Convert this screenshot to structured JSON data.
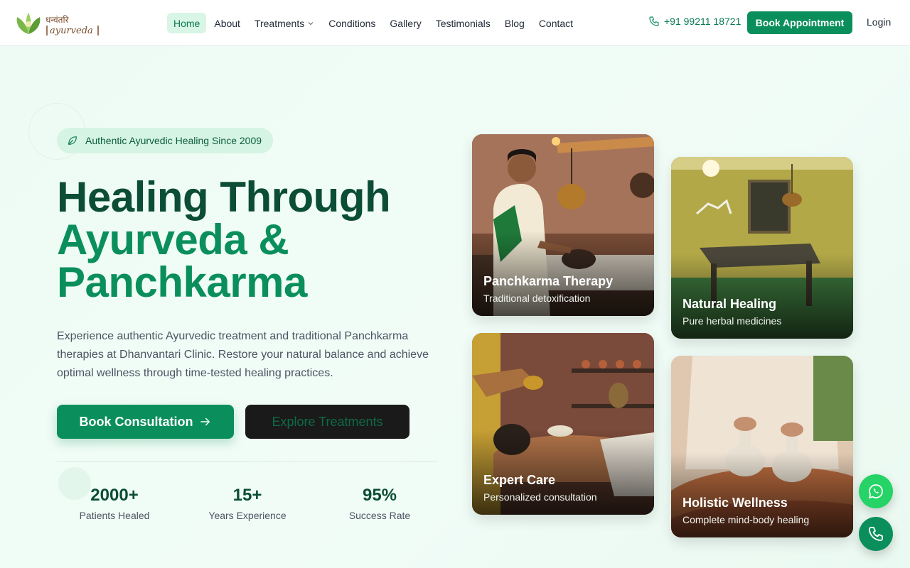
{
  "header": {
    "logo_text": "धन्वंतरि Ayurveda",
    "nav": [
      {
        "label": "Home"
      },
      {
        "label": "About"
      },
      {
        "label": "Treatments"
      },
      {
        "label": "Conditions"
      },
      {
        "label": "Gallery"
      },
      {
        "label": "Testimonials"
      },
      {
        "label": "Blog"
      },
      {
        "label": "Contact"
      }
    ],
    "phone": "+91 99211 18721",
    "book_label": "Book Appointment",
    "login_label": "Login"
  },
  "hero": {
    "badge": "Authentic Ayurvedic Healing Since 2009",
    "title_line1": "Healing Through",
    "title_line2": "Ayurveda &",
    "title_line3": "Panchkarma",
    "description": "Experience authentic Ayurvedic treatment and traditional Panchkarma therapies at Dhanvantari Clinic. Restore your natural balance and achieve optimal wellness through time-tested healing practices.",
    "primary_cta": "Book Consultation",
    "secondary_cta": "Explore Treatments",
    "stats": [
      {
        "value": "2000+",
        "label": "Patients Healed"
      },
      {
        "value": "15+",
        "label": "Years Experience"
      },
      {
        "value": "95%",
        "label": "Success Rate"
      }
    ]
  },
  "cards": [
    {
      "title": "Panchkarma Therapy",
      "subtitle": "Traditional detoxification"
    },
    {
      "title": "Natural Healing",
      "subtitle": "Pure herbal medicines"
    },
    {
      "title": "Expert Care",
      "subtitle": "Personalized consultation"
    },
    {
      "title": "Holistic Wellness",
      "subtitle": "Complete mind-body healing"
    }
  ],
  "colors": {
    "brand_green": "#0a8f5c",
    "dark_green": "#0b4d36",
    "whatsapp": "#25d366"
  },
  "icons": {
    "phone": "phone-icon",
    "leaf": "leaf-icon",
    "arrow": "arrow-right-icon",
    "whatsapp": "whatsapp-icon",
    "chevron": "chevron-down-icon"
  }
}
